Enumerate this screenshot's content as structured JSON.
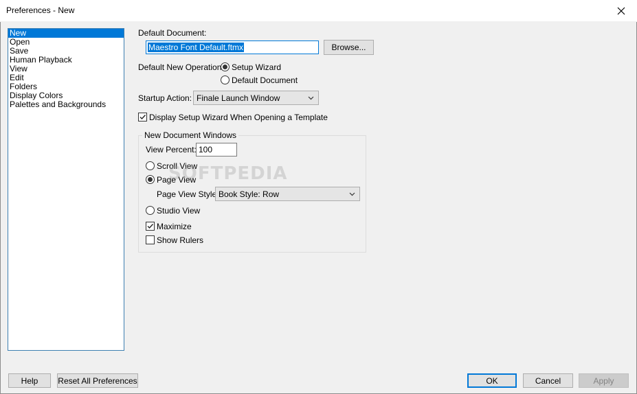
{
  "window": {
    "title": "Preferences - New",
    "close_icon": "close-icon"
  },
  "categories": [
    {
      "label": "New",
      "selected": true
    },
    {
      "label": "Open",
      "selected": false
    },
    {
      "label": "Save",
      "selected": false
    },
    {
      "label": "Human Playback",
      "selected": false
    },
    {
      "label": "View",
      "selected": false
    },
    {
      "label": "Edit",
      "selected": false
    },
    {
      "label": "Folders",
      "selected": false
    },
    {
      "label": "Display Colors",
      "selected": false
    },
    {
      "label": "Palettes and Backgrounds",
      "selected": false
    }
  ],
  "default_document": {
    "label": "Default Document:",
    "value": "Maestro Font Default.ftmx",
    "browse_label": "Browse..."
  },
  "default_new_operation": {
    "label": "Default New Operation:",
    "options": [
      {
        "label": "Setup Wizard",
        "checked": true
      },
      {
        "label": "Default Document",
        "checked": false
      }
    ]
  },
  "startup_action": {
    "label": "Startup Action:",
    "value": "Finale Launch Window"
  },
  "display_setup_wizard": {
    "label": "Display Setup Wizard When Opening a Template",
    "checked": true
  },
  "new_document_windows": {
    "caption": "New Document Windows",
    "view_percent_label": "View Percent:",
    "view_percent_value": "100",
    "scroll_view_label": "Scroll View",
    "scroll_view_checked": false,
    "page_view_label": "Page View",
    "page_view_checked": true,
    "page_view_style_label": "Page View Style:",
    "page_view_style_value": "Book Style: Row",
    "studio_view_label": "Studio View",
    "studio_view_checked": false,
    "maximize_label": "Maximize",
    "maximize_checked": true,
    "show_rulers_label": "Show Rulers",
    "show_rulers_checked": false
  },
  "watermark": "SOFTPEDIA",
  "buttons": {
    "help": "Help",
    "reset_all": "Reset All Preferences",
    "ok": "OK",
    "cancel": "Cancel",
    "apply": "Apply"
  },
  "colors": {
    "accent": "#0078d7",
    "selection_bg": "#0078d7",
    "list_border": "#3c7fb1"
  }
}
